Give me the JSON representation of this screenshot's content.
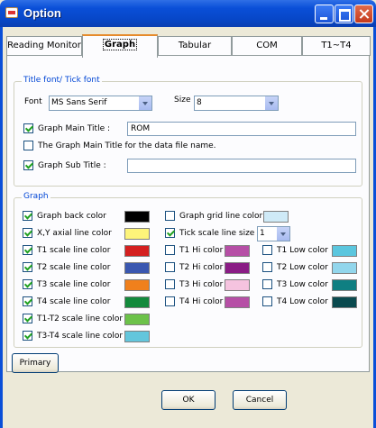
{
  "window": {
    "title": "Option"
  },
  "tabs": [
    {
      "label": "Reading Monitor",
      "active": false
    },
    {
      "label": "Graph",
      "active": true
    },
    {
      "label": "Tabular",
      "active": false
    },
    {
      "label": "COM",
      "active": false
    },
    {
      "label": "T1~T4",
      "active": false
    }
  ],
  "title_font": {
    "group_label": "Title font/ Tick font",
    "font_label": "Font",
    "font_value": "MS Sans Serif",
    "size_label": "Size",
    "size_value": "8",
    "main_title_label": "Graph Main Title :",
    "main_title_checked": true,
    "main_title_value": "ROM",
    "datafile_label": "The Graph Main Title for the data file name.",
    "datafile_checked": false,
    "sub_title_label": "Graph Sub Title :",
    "sub_title_checked": true,
    "sub_title_value": ""
  },
  "graph": {
    "group_label": "Graph",
    "left": [
      {
        "label": "Graph back color",
        "checked": true,
        "color": "#000000"
      },
      {
        "label": "X,Y axial line color",
        "checked": true,
        "color": "#fdf47a"
      },
      {
        "label": "T1 scale line color",
        "checked": true,
        "color": "#d42020"
      },
      {
        "label": "T2 scale line color",
        "checked": true,
        "color": "#3a57b0"
      },
      {
        "label": "T3 scale line color",
        "checked": true,
        "color": "#f0801c"
      },
      {
        "label": "T4 scale line color",
        "checked": true,
        "color": "#138a3c"
      },
      {
        "label": "T1-T2 scale line color",
        "checked": true,
        "color": "#6cc24a"
      },
      {
        "label": "T3-T4 scale line color",
        "checked": true,
        "color": "#63c6dc"
      }
    ],
    "grid_line": {
      "label": "Graph grid line color",
      "checked": false,
      "color": "#cfeaf7"
    },
    "tick_size": {
      "label": "Tick scale line size",
      "checked": true,
      "value": "1"
    },
    "hi": [
      {
        "label": "T1 Hi color",
        "checked": false,
        "color": "#b64fa6"
      },
      {
        "label": "T2 Hi color",
        "checked": false,
        "color": "#8a1c85"
      },
      {
        "label": "T3 Hi color",
        "checked": false,
        "color": "#f5c3df"
      },
      {
        "label": "T4 Hi color",
        "checked": false,
        "color": "#b64fa6"
      }
    ],
    "low": [
      {
        "label": "T1 Low color",
        "checked": false,
        "color": "#5bc6de"
      },
      {
        "label": "T2 Low color",
        "checked": false,
        "color": "#92d6ec"
      },
      {
        "label": "T3 Low color",
        "checked": false,
        "color": "#0f7f82"
      },
      {
        "label": "T4 Low color",
        "checked": false,
        "color": "#0a4a4f"
      }
    ]
  },
  "buttons": {
    "primary": "Primary",
    "ok": "OK",
    "cancel": "Cancel"
  }
}
